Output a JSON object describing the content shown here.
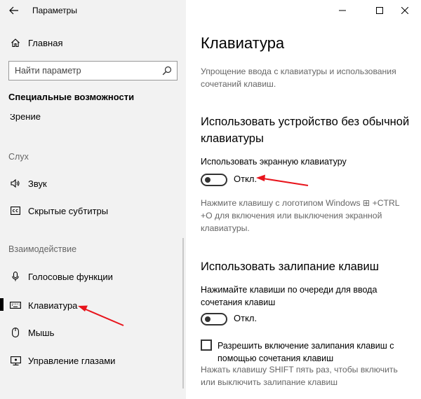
{
  "window": {
    "title": "Параметры",
    "controls": [
      "minimize-icon",
      "maximize-icon",
      "close-icon"
    ]
  },
  "sidebar": {
    "home_label": "Главная",
    "search_placeholder": "Найти параметр",
    "category_title": "Специальные возможности",
    "partial_item": "Зрение",
    "sections": [
      {
        "header": "Слух",
        "items": [
          {
            "label": "Звук",
            "icon": "speaker-icon"
          },
          {
            "label": "Скрытые субтитры",
            "icon": "closed-captions-icon"
          }
        ]
      },
      {
        "header": "Взаимодействие",
        "items": [
          {
            "label": "Голосовые функции",
            "icon": "microphone-icon"
          },
          {
            "label": "Клавиатура",
            "icon": "keyboard-icon",
            "selected": true
          },
          {
            "label": "Мышь",
            "icon": "mouse-icon"
          },
          {
            "label": "Управление глазами",
            "icon": "eye-control-icon"
          }
        ]
      }
    ]
  },
  "main": {
    "title": "Клавиатура",
    "intro": "Упрощение ввода с клавиатуры и использования сочетаний клавиш.",
    "osk": {
      "heading": "Использовать устройство без обычной клавиатуры",
      "setting_label": "Использовать экранную клавиатуру",
      "state": "Откл.",
      "on": false,
      "hint": "Нажмите клавишу с логотипом Windows ⊞ +CTRL +O для включения или выключения экранной клавиатуры."
    },
    "sticky": {
      "heading": "Использовать залипание клавиш",
      "setting_label": "Нажимайте клавиши по очереди для ввода сочетания клавиш",
      "state": "Откл.",
      "on": false,
      "checkbox_label": "Разрешить включение залипания клавиш с помощью сочетания клавиш",
      "checkbox_checked": false,
      "checkbox_hint": "Нажать клавишу SHIFT пять раз, чтобы включить или выключить залипание клавиш"
    }
  },
  "annotation_color": "#e8141c"
}
